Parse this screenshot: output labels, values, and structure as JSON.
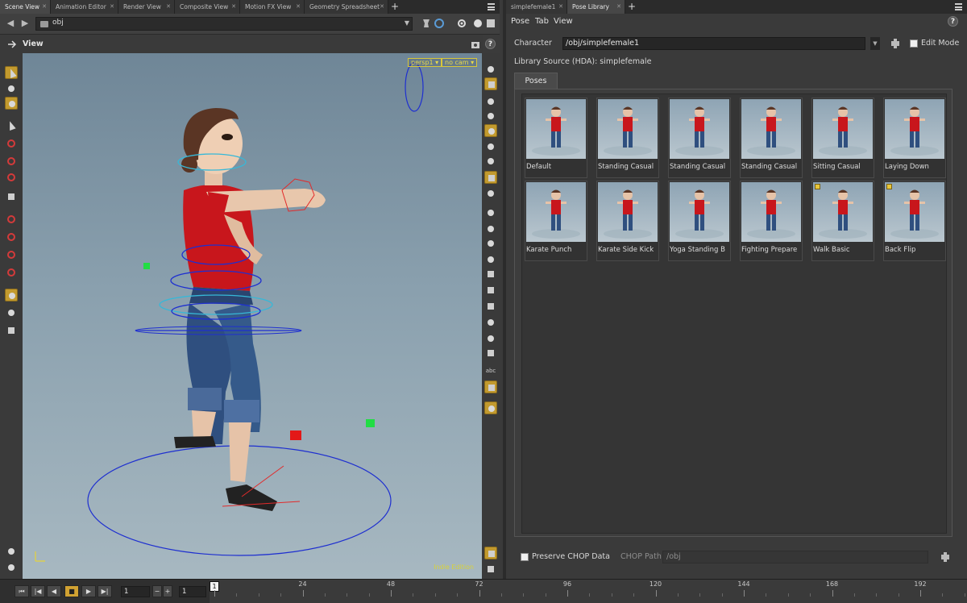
{
  "left_tabs": [
    "Scene View",
    "Animation Editor",
    "Render View",
    "Composite View",
    "Motion FX View",
    "Geometry Spreadsheet"
  ],
  "right_tabs": [
    "simplefemale1",
    "Pose Library"
  ],
  "path": "obj",
  "view_title": "View",
  "viewport": {
    "camera_menu": "persp1",
    "cam_menu": "no cam",
    "watermark": "Indie Edition"
  },
  "menu": [
    "Pose",
    "Tab",
    "View"
  ],
  "character": {
    "label": "Character",
    "value": "/obj/simplefemale1"
  },
  "edit_mode_label": "Edit Mode",
  "library_source": "Library Source (HDA): simplefemale",
  "poses_tab": "Poses",
  "poses": [
    {
      "label": "Default",
      "star": false
    },
    {
      "label": "Standing Casual",
      "star": false
    },
    {
      "label": "Standing Casual",
      "star": false
    },
    {
      "label": "Standing Casual",
      "star": false
    },
    {
      "label": "Sitting Casual",
      "star": false
    },
    {
      "label": "Laying Down",
      "star": false
    },
    {
      "label": "Karate Punch",
      "star": false
    },
    {
      "label": "Karate Side Kick",
      "star": false
    },
    {
      "label": "Yoga Standing B",
      "star": false
    },
    {
      "label": "Fighting Prepare",
      "star": false
    },
    {
      "label": "Walk Basic",
      "star": true
    },
    {
      "label": "Back Flip",
      "star": true
    }
  ],
  "preserve_chop_label": "Preserve CHOP Data",
  "chop_path": {
    "label": "CHOP Path",
    "value": "/obj"
  },
  "timeline": {
    "frame": "1",
    "start": "1",
    "current_marker": "1",
    "ruler_labels": [
      "24",
      "48",
      "72",
      "96",
      "120",
      "144",
      "168",
      "192"
    ]
  },
  "colors": {
    "accent": "#d1a232",
    "viewport_top": "#6f8697",
    "viewport_bottom": "#a7b8c1",
    "shirt": "#c8161c",
    "jeans": "#2f4f7f"
  }
}
